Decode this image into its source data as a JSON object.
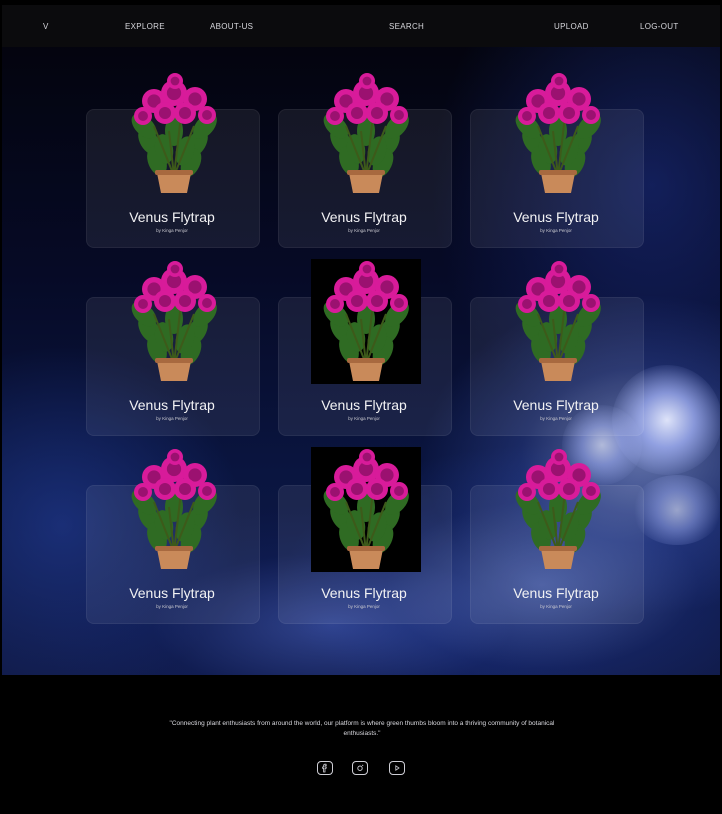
{
  "nav": {
    "logo": "V",
    "explore": "EXPLORE",
    "about": "ABOUT-US",
    "search": "SEARCH",
    "upload": "UPLOAD",
    "logout": "LOG-OUT"
  },
  "cards": [
    {
      "title": "Venus Flytrap",
      "author": "by Kinga Penjor"
    },
    {
      "title": "Venus Flytrap",
      "author": "by Kinga Penjor"
    },
    {
      "title": "Venus Flytrap",
      "author": "by Kinga Penjor"
    },
    {
      "title": "Venus Flytrap",
      "author": "by Kinga Penjor"
    },
    {
      "title": "Venus Flytrap",
      "author": "by Kinga Penjor"
    },
    {
      "title": "Venus Flytrap",
      "author": "by Kinga Penjor"
    },
    {
      "title": "Venus Flytrap",
      "author": "by Kinga Penjor"
    },
    {
      "title": "Venus Flytrap",
      "author": "by Kinga Penjor"
    },
    {
      "title": "Venus Flytrap",
      "author": "by Kinga Penjor"
    }
  ],
  "footer": {
    "quote": "\"Connecting plant enthusiasts from around the world, our platform is where green thumbs bloom into a thriving community of botanical enthusiasts.\"",
    "social_icons": [
      "facebook-icon",
      "instagram-icon",
      "youtube-icon"
    ]
  },
  "colors": {
    "bloom": "#d81b9a",
    "bloom_dark": "#9b1170",
    "leaf": "#2f6b23",
    "pot": "#c98a5a"
  }
}
